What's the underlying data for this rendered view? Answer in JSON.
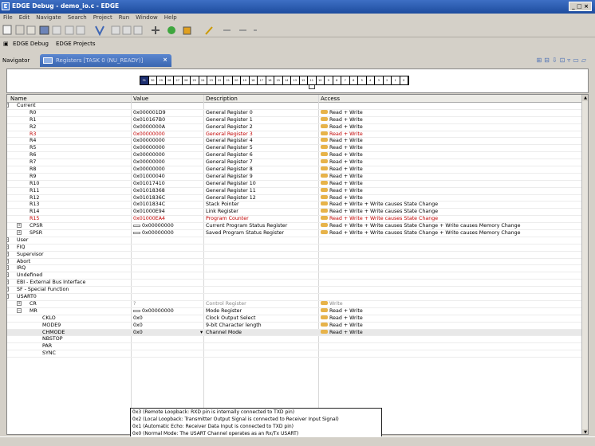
{
  "window": {
    "title": "EDGE Debug - demo_io.c - EDGE",
    "controls": "_ □ ×"
  },
  "menu": [
    "File",
    "Edit",
    "Navigate",
    "Search",
    "Project",
    "Run",
    "Window",
    "Help"
  ],
  "perspectives": [
    "EDGE Debug",
    "EDGE Projects"
  ],
  "tabs": {
    "navigator": "Navigator",
    "registers": "Registers [TASK 0 (NU_READY)]"
  },
  "bits": [
    "31",
    "30",
    "29",
    "28",
    "27",
    "26",
    "25",
    "24",
    "23",
    "22",
    "21",
    "20",
    "19",
    "18",
    "17",
    "16",
    "15",
    "14",
    "13",
    "12",
    "11",
    "10",
    "9",
    "8",
    "7",
    "6",
    "5",
    "4",
    "3",
    "2",
    "1",
    "0"
  ],
  "columns": {
    "name": "Name",
    "value": "Value",
    "description": "Description",
    "access": "Access"
  },
  "rows": [
    {
      "name": "Current",
      "indent": 1,
      "exp": "−",
      "value": "",
      "desc": "",
      "access": ""
    },
    {
      "name": "R0",
      "indent": 3,
      "value": "0x000001D9",
      "desc": "General Register 0",
      "access": "Read + Write"
    },
    {
      "name": "R1",
      "indent": 3,
      "value": "0x010167B0",
      "desc": "General Register 1",
      "access": "Read + Write"
    },
    {
      "name": "R2",
      "indent": 3,
      "value": "0x0000000A",
      "desc": "General Register 2",
      "access": "Read + Write"
    },
    {
      "name": "R3",
      "indent": 3,
      "value": "0x00000000",
      "desc": "General Register 3",
      "access": "Read + Write",
      "red": true
    },
    {
      "name": "R4",
      "indent": 3,
      "value": "0x00000000",
      "desc": "General Register 4",
      "access": "Read + Write"
    },
    {
      "name": "R5",
      "indent": 3,
      "value": "0x00000000",
      "desc": "General Register 5",
      "access": "Read + Write"
    },
    {
      "name": "R6",
      "indent": 3,
      "value": "0x00000000",
      "desc": "General Register 6",
      "access": "Read + Write"
    },
    {
      "name": "R7",
      "indent": 3,
      "value": "0x00000000",
      "desc": "General Register 7",
      "access": "Read + Write"
    },
    {
      "name": "R8",
      "indent": 3,
      "value": "0x00000000",
      "desc": "General Register 8",
      "access": "Read + Write"
    },
    {
      "name": "R9",
      "indent": 3,
      "value": "0x01000040",
      "desc": "General Register 9",
      "access": "Read + Write"
    },
    {
      "name": "R10",
      "indent": 3,
      "value": "0x01017410",
      "desc": "General Register 10",
      "access": "Read + Write"
    },
    {
      "name": "R11",
      "indent": 3,
      "value": "0x01018368",
      "desc": "General Register 11",
      "access": "Read + Write"
    },
    {
      "name": "R12",
      "indent": 3,
      "value": "0x0101836C",
      "desc": "General Register 12",
      "access": "Read + Write"
    },
    {
      "name": "R13",
      "indent": 3,
      "value": "0x0101834C",
      "desc": "Stack Pointer",
      "access": "Read + Write + Write causes State Change"
    },
    {
      "name": "R14",
      "indent": 3,
      "value": "0x01000E94",
      "desc": "Link Register",
      "access": "Read + Write + Write causes State Change"
    },
    {
      "name": "R15",
      "indent": 3,
      "value": "0x01000EA4",
      "desc": "Program Counter",
      "access": "Read + Write + Write causes State Change",
      "red": true
    },
    {
      "name": "CPSR",
      "indent": 3,
      "exp": "+",
      "value": "0x00000000",
      "valicon": true,
      "desc": "Current Program Status Register",
      "access": "Read + Write + Write causes State Change + Write causes Memory Change"
    },
    {
      "name": "SPSR",
      "indent": 3,
      "exp": "+",
      "value": "0x00000000",
      "valicon": true,
      "desc": "Saved Program Status Register",
      "access": "Read + Write + Write causes State Change + Write causes Memory Change"
    },
    {
      "name": "User",
      "indent": 1,
      "exp": "+",
      "value": "",
      "desc": "",
      "access": ""
    },
    {
      "name": "FIQ",
      "indent": 1,
      "exp": "+",
      "value": "",
      "desc": "",
      "access": ""
    },
    {
      "name": "Supervisor",
      "indent": 1,
      "exp": "+",
      "value": "",
      "desc": "",
      "access": ""
    },
    {
      "name": "Abort",
      "indent": 1,
      "exp": "+",
      "value": "",
      "desc": "",
      "access": ""
    },
    {
      "name": "IRQ",
      "indent": 1,
      "exp": "+",
      "value": "",
      "desc": "",
      "access": ""
    },
    {
      "name": "Undefined",
      "indent": 1,
      "exp": "+",
      "value": "",
      "desc": "",
      "access": ""
    },
    {
      "name": "EBI - External Bus Interface",
      "indent": 1,
      "exp": "+",
      "value": "",
      "desc": "",
      "access": ""
    },
    {
      "name": "SF - Special Function",
      "indent": 1,
      "exp": "+",
      "value": "",
      "desc": "",
      "access": ""
    },
    {
      "name": "USART0",
      "indent": 1,
      "exp": "−",
      "value": "",
      "desc": "",
      "access": ""
    },
    {
      "name": "CR",
      "indent": 3,
      "exp": "+",
      "value": "?",
      "desc": "Control Register",
      "access": "Write",
      "grey": true
    },
    {
      "name": "MR",
      "indent": 3,
      "exp": "−",
      "value": "0x00000000",
      "valicon": true,
      "desc": "Mode Register",
      "access": "Read + Write"
    },
    {
      "name": "CKLO",
      "indent": 5,
      "value": "0x0",
      "desc": "Clock Output Select",
      "access": "Read + Write"
    },
    {
      "name": "MODE9",
      "indent": 5,
      "value": "0x0",
      "desc": "9-bit Character length",
      "access": "Read + Write"
    },
    {
      "name": "CHMODE",
      "indent": 5,
      "value": "0x0",
      "desc": "Channel Mode",
      "access": "Read + Write",
      "selected": true
    },
    {
      "name": "NBSTOP",
      "indent": 5,
      "value": "",
      "desc": "",
      "access": ""
    },
    {
      "name": "PAR",
      "indent": 5,
      "value": "",
      "desc": "",
      "access": ""
    },
    {
      "name": "SYNC",
      "indent": 5,
      "value": "",
      "desc": "",
      "access": ""
    }
  ],
  "dropdown": [
    "0x3 (Remote Loopback: RXD pin is internally connected to TXD pin)",
    "0x2 (Local Loopback: Transmitter Output Signal is connected to Receiver Input Signal)",
    "0x1 (Automatic Echo: Receiver Data Input is connected to TXD pin)",
    "0x0 (Normal Mode: The USART Channel operates as an Rx/Tx USART)"
  ],
  "colors": {
    "title_bar": "#1d4c9e",
    "changed_value": "#c00000",
    "selected_bit": "#1d2f70"
  }
}
